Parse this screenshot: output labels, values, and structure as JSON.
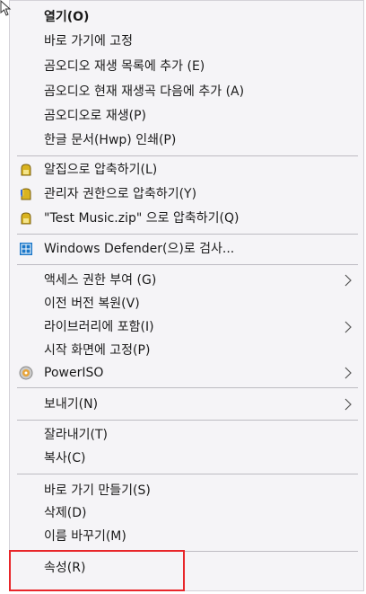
{
  "menu": {
    "items": [
      {
        "label": "열기(O)"
      },
      {
        "label": "바로 가기에 고정"
      },
      {
        "label": "곰오디오 재생 목록에 추가 (E)"
      },
      {
        "label": "곰오디오 현재 재생곡 다음에 추가 (A)"
      },
      {
        "label": "곰오디오로 재생(P)"
      },
      {
        "label": "한글 문서(Hwp) 인쇄(P)"
      },
      {
        "label": "알집으로 압축하기(L)",
        "icon": "alzip-icon"
      },
      {
        "label": "관리자 권한으로 압축하기(Y)",
        "icon": "alzip-admin-icon"
      },
      {
        "label": "\"Test Music.zip\" 으로 압축하기(Q)",
        "icon": "alzip-icon"
      },
      {
        "label": "Windows Defender(으)로 검사...",
        "icon": "windows-defender-icon"
      },
      {
        "label": "액세스 권한 부여 (G)",
        "submenu": true
      },
      {
        "label": "이전 버전 복원(V)"
      },
      {
        "label": "라이브러리에 포함(I)",
        "submenu": true
      },
      {
        "label": "시작 화면에 고정(P)"
      },
      {
        "label": "PowerISO",
        "icon": "poweriso-icon",
        "submenu": true
      },
      {
        "label": "보내기(N)",
        "submenu": true
      },
      {
        "label": "잘라내기(T)"
      },
      {
        "label": "복사(C)"
      },
      {
        "label": "바로 가기 만들기(S)"
      },
      {
        "label": "삭제(D)"
      },
      {
        "label": "이름 바꾸기(M)"
      },
      {
        "label": "속성(R)"
      }
    ]
  },
  "colors": {
    "menu_background": "#f5f4f7",
    "separator": "#bdbbc2",
    "highlight_border": "#e8262a",
    "text": "#1a1a1a"
  }
}
